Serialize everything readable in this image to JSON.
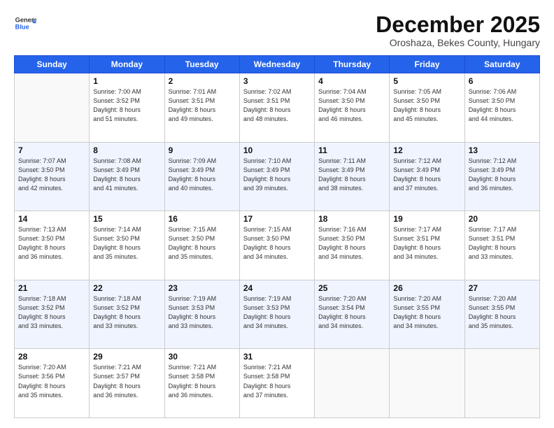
{
  "logo": {
    "general": "General",
    "blue": "Blue"
  },
  "header": {
    "month": "December 2025",
    "location": "Oroshaza, Bekes County, Hungary"
  },
  "weekdays": [
    "Sunday",
    "Monday",
    "Tuesday",
    "Wednesday",
    "Thursday",
    "Friday",
    "Saturday"
  ],
  "weeks": [
    [
      {
        "day": "",
        "info": ""
      },
      {
        "day": "1",
        "info": "Sunrise: 7:00 AM\nSunset: 3:52 PM\nDaylight: 8 hours\nand 51 minutes."
      },
      {
        "day": "2",
        "info": "Sunrise: 7:01 AM\nSunset: 3:51 PM\nDaylight: 8 hours\nand 49 minutes."
      },
      {
        "day": "3",
        "info": "Sunrise: 7:02 AM\nSunset: 3:51 PM\nDaylight: 8 hours\nand 48 minutes."
      },
      {
        "day": "4",
        "info": "Sunrise: 7:04 AM\nSunset: 3:50 PM\nDaylight: 8 hours\nand 46 minutes."
      },
      {
        "day": "5",
        "info": "Sunrise: 7:05 AM\nSunset: 3:50 PM\nDaylight: 8 hours\nand 45 minutes."
      },
      {
        "day": "6",
        "info": "Sunrise: 7:06 AM\nSunset: 3:50 PM\nDaylight: 8 hours\nand 44 minutes."
      }
    ],
    [
      {
        "day": "7",
        "info": "Sunrise: 7:07 AM\nSunset: 3:50 PM\nDaylight: 8 hours\nand 42 minutes."
      },
      {
        "day": "8",
        "info": "Sunrise: 7:08 AM\nSunset: 3:49 PM\nDaylight: 8 hours\nand 41 minutes."
      },
      {
        "day": "9",
        "info": "Sunrise: 7:09 AM\nSunset: 3:49 PM\nDaylight: 8 hours\nand 40 minutes."
      },
      {
        "day": "10",
        "info": "Sunrise: 7:10 AM\nSunset: 3:49 PM\nDaylight: 8 hours\nand 39 minutes."
      },
      {
        "day": "11",
        "info": "Sunrise: 7:11 AM\nSunset: 3:49 PM\nDaylight: 8 hours\nand 38 minutes."
      },
      {
        "day": "12",
        "info": "Sunrise: 7:12 AM\nSunset: 3:49 PM\nDaylight: 8 hours\nand 37 minutes."
      },
      {
        "day": "13",
        "info": "Sunrise: 7:12 AM\nSunset: 3:49 PM\nDaylight: 8 hours\nand 36 minutes."
      }
    ],
    [
      {
        "day": "14",
        "info": "Sunrise: 7:13 AM\nSunset: 3:50 PM\nDaylight: 8 hours\nand 36 minutes."
      },
      {
        "day": "15",
        "info": "Sunrise: 7:14 AM\nSunset: 3:50 PM\nDaylight: 8 hours\nand 35 minutes."
      },
      {
        "day": "16",
        "info": "Sunrise: 7:15 AM\nSunset: 3:50 PM\nDaylight: 8 hours\nand 35 minutes."
      },
      {
        "day": "17",
        "info": "Sunrise: 7:15 AM\nSunset: 3:50 PM\nDaylight: 8 hours\nand 34 minutes."
      },
      {
        "day": "18",
        "info": "Sunrise: 7:16 AM\nSunset: 3:50 PM\nDaylight: 8 hours\nand 34 minutes."
      },
      {
        "day": "19",
        "info": "Sunrise: 7:17 AM\nSunset: 3:51 PM\nDaylight: 8 hours\nand 34 minutes."
      },
      {
        "day": "20",
        "info": "Sunrise: 7:17 AM\nSunset: 3:51 PM\nDaylight: 8 hours\nand 33 minutes."
      }
    ],
    [
      {
        "day": "21",
        "info": "Sunrise: 7:18 AM\nSunset: 3:52 PM\nDaylight: 8 hours\nand 33 minutes."
      },
      {
        "day": "22",
        "info": "Sunrise: 7:18 AM\nSunset: 3:52 PM\nDaylight: 8 hours\nand 33 minutes."
      },
      {
        "day": "23",
        "info": "Sunrise: 7:19 AM\nSunset: 3:53 PM\nDaylight: 8 hours\nand 33 minutes."
      },
      {
        "day": "24",
        "info": "Sunrise: 7:19 AM\nSunset: 3:53 PM\nDaylight: 8 hours\nand 34 minutes."
      },
      {
        "day": "25",
        "info": "Sunrise: 7:20 AM\nSunset: 3:54 PM\nDaylight: 8 hours\nand 34 minutes."
      },
      {
        "day": "26",
        "info": "Sunrise: 7:20 AM\nSunset: 3:55 PM\nDaylight: 8 hours\nand 34 minutes."
      },
      {
        "day": "27",
        "info": "Sunrise: 7:20 AM\nSunset: 3:55 PM\nDaylight: 8 hours\nand 35 minutes."
      }
    ],
    [
      {
        "day": "28",
        "info": "Sunrise: 7:20 AM\nSunset: 3:56 PM\nDaylight: 8 hours\nand 35 minutes."
      },
      {
        "day": "29",
        "info": "Sunrise: 7:21 AM\nSunset: 3:57 PM\nDaylight: 8 hours\nand 36 minutes."
      },
      {
        "day": "30",
        "info": "Sunrise: 7:21 AM\nSunset: 3:58 PM\nDaylight: 8 hours\nand 36 minutes."
      },
      {
        "day": "31",
        "info": "Sunrise: 7:21 AM\nSunset: 3:58 PM\nDaylight: 8 hours\nand 37 minutes."
      },
      {
        "day": "",
        "info": ""
      },
      {
        "day": "",
        "info": ""
      },
      {
        "day": "",
        "info": ""
      }
    ]
  ]
}
